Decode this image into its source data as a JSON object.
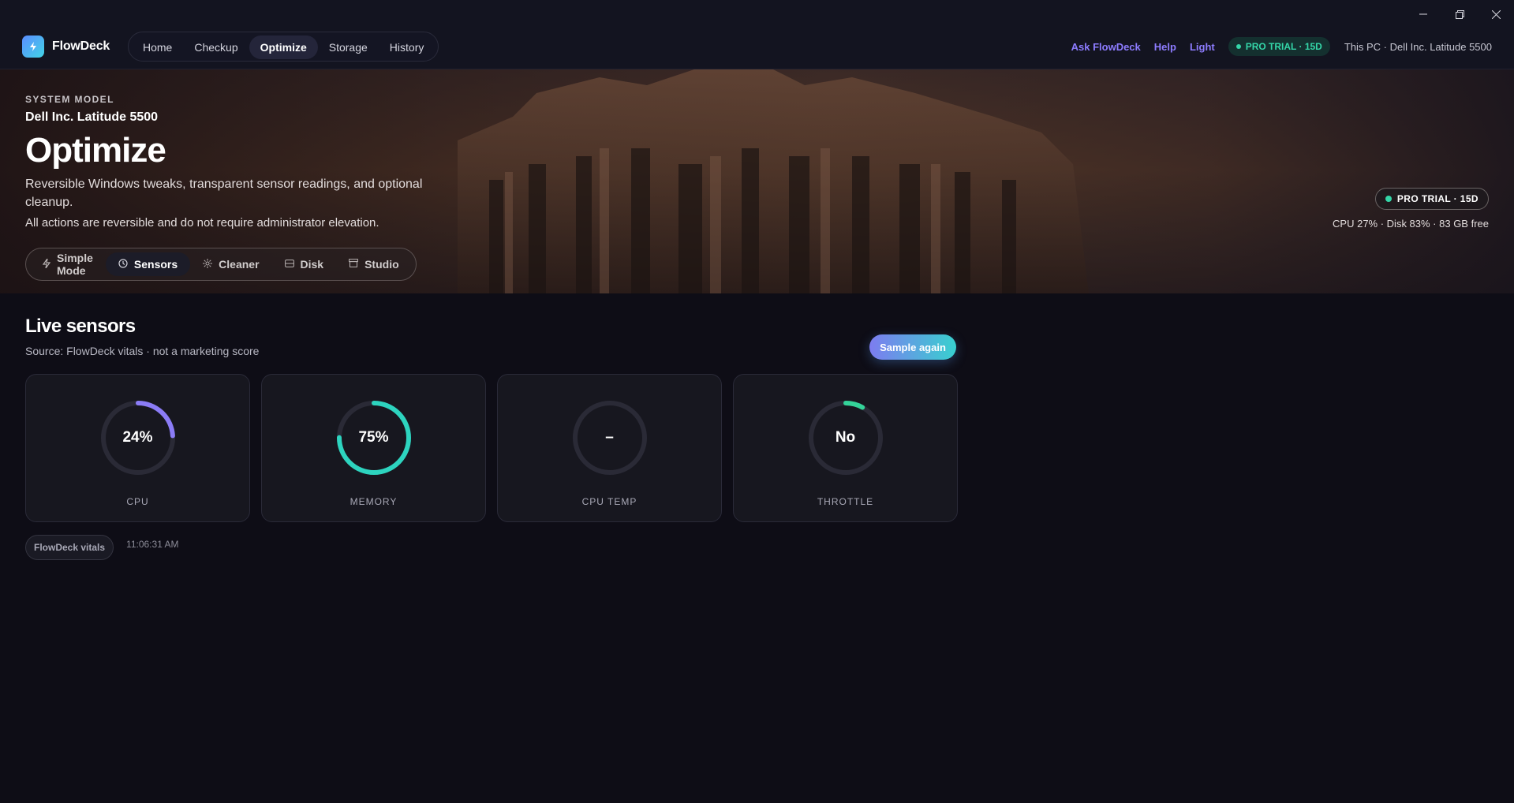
{
  "window": {
    "minimize_icon": "minimize-icon",
    "maximize_icon": "restore-icon",
    "close_icon": "close-icon"
  },
  "app": {
    "name": "FlowDeck",
    "logo_icon": "lightning-icon"
  },
  "nav": {
    "items": [
      "Home",
      "Checkup",
      "Optimize",
      "Storage",
      "History"
    ],
    "active": "Optimize"
  },
  "header": {
    "ask": "Ask FlowDeck",
    "help": "Help",
    "theme": "Light",
    "pro_badge": "PRO TRIAL · 15D",
    "pc_label": "This PC · Dell Inc. Latitude 5500"
  },
  "hero": {
    "eyebrow": "SYSTEM MODEL",
    "model": "Dell Inc. Latitude 5500",
    "title": "Optimize",
    "subtitle": "Reversible Windows tweaks, transparent sensor readings, and optional cleanup.",
    "note": "All actions are reversible and do not require administrator elevation.",
    "tabs": [
      {
        "label": "Simple Mode",
        "icon": "lightning-icon"
      },
      {
        "label": "Sensors",
        "icon": "clock-icon"
      },
      {
        "label": "Cleaner",
        "icon": "sparkle-icon"
      },
      {
        "label": "Disk",
        "icon": "disk-icon"
      },
      {
        "label": "Studio",
        "icon": "box-icon"
      }
    ],
    "active_tab": "Sensors",
    "pro_badge": "PRO TRIAL · 15D",
    "stats": "CPU 27% · Disk 83% · 83 GB free"
  },
  "sensors": {
    "title": "Live sensors",
    "subtitle": "Source: FlowDeck vitals · not a marketing score",
    "sample_button": "Sample again",
    "cards": [
      {
        "label": "CPU",
        "value": "24%",
        "fill": 0.24,
        "color": "#8b7cf6"
      },
      {
        "label": "MEMORY",
        "value": "75%",
        "fill": 0.75,
        "color": "#2dd4bf"
      },
      {
        "label": "CPU TEMP",
        "value": "–",
        "fill": 0,
        "color": "#8b7cf6"
      },
      {
        "label": "THROTTLE",
        "value": "No",
        "fill": 0.08,
        "color": "#34d399"
      }
    ],
    "source_chip": "FlowDeck vitals",
    "timestamp": "11:06:31 AM"
  },
  "colors": {
    "accent": "#8d7cff",
    "teal": "#34d6a8",
    "background": "#0e0d16"
  }
}
